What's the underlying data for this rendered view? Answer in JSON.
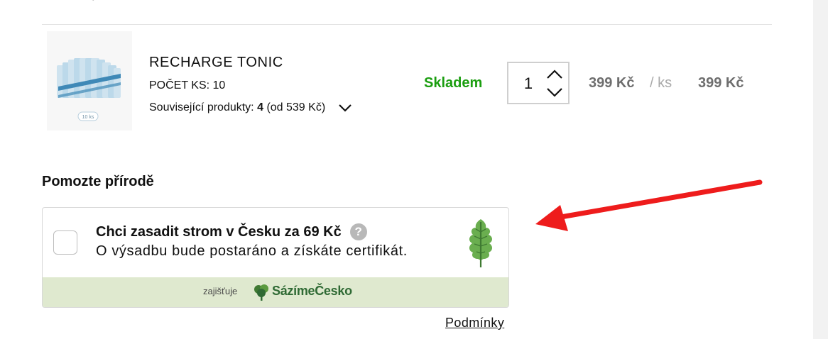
{
  "product": {
    "name": "RECHARGE TONIC",
    "pieces": "POČET KS: 10",
    "related_label": "Související produkty:",
    "related_count": "4",
    "related_from": "(od 539 Kč)",
    "package_label": "10 ks",
    "stock_status": "Skladem",
    "quantity": "1",
    "unit_price": "399 Kč",
    "per_unit": "/ ks",
    "total_price": "399 Kč"
  },
  "nature": {
    "section_title": "Pomozte přírodě",
    "offer_title": "Chci zasadit strom v Česku za 69 Kč",
    "help_glyph": "?",
    "offer_subtitle": "O výsadbu bude postaráno a získáte certifikát.",
    "provided_by": "zajišťuje",
    "brand": "SázímeČesko",
    "terms_link": "Podmínky",
    "checked": false
  },
  "icons": {
    "product_image": "product-image",
    "related_toggle": "chevron-down-icon",
    "qty_increase": "chevron-up-icon",
    "qty_decrease": "chevron-down-icon",
    "help": "question-circle-icon",
    "leaf": "oak-leaf-icon",
    "brand_logo": "tree-logo-icon",
    "annotation": "red-arrow-icon"
  },
  "colors": {
    "stock_green": "#1b9e10",
    "footer_green": "#dfe9cf",
    "brand_green": "#2f6a34",
    "arrow_red": "#ee1c1c",
    "leaf_green": "#6aae4f"
  }
}
